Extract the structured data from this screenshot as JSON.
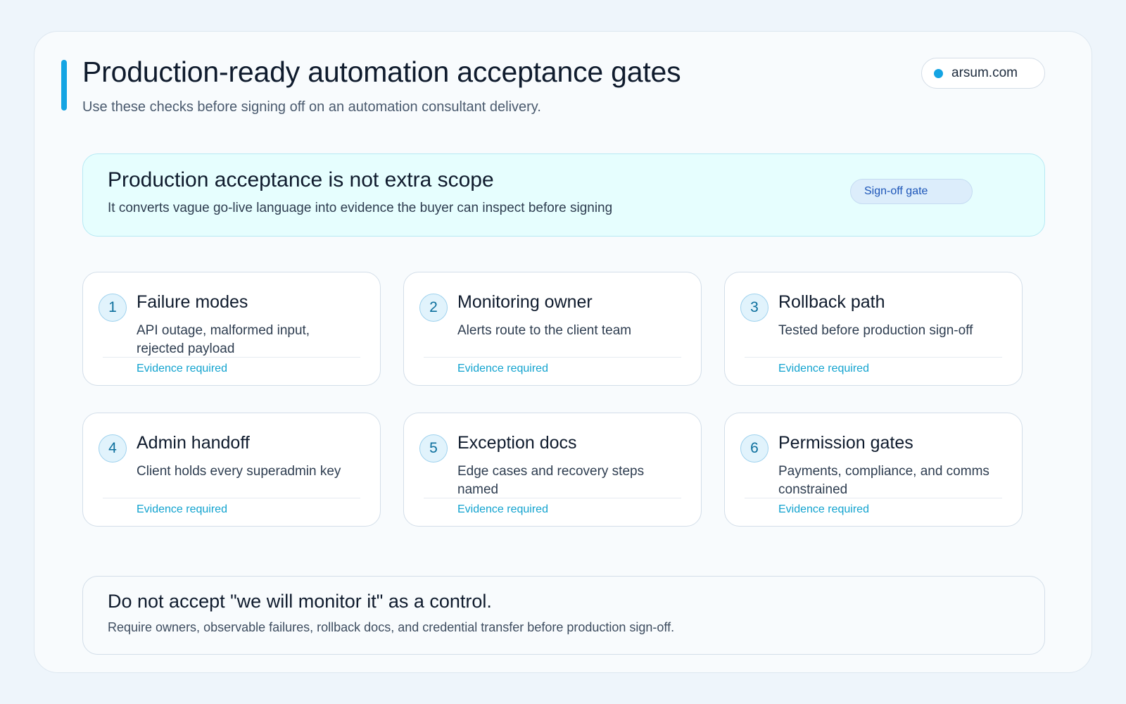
{
  "header": {
    "title": "Production-ready automation acceptance gates",
    "subtitle": "Use these checks before signing off on an automation consultant delivery.",
    "domain": "arsum.com"
  },
  "banner": {
    "title": "Production acceptance is not extra scope",
    "text": "It converts vague go-live language into evidence the buyer can inspect before signing",
    "badge": "Sign-off gate"
  },
  "gates": [
    {
      "number": "1",
      "title": "Failure modes",
      "description": "API outage, malformed input, rejected payload",
      "status": "Evidence required"
    },
    {
      "number": "2",
      "title": "Monitoring owner",
      "description": "Alerts route to the client team",
      "status": "Evidence required"
    },
    {
      "number": "3",
      "title": "Rollback path",
      "description": "Tested before production sign-off",
      "status": "Evidence required"
    },
    {
      "number": "4",
      "title": "Admin handoff",
      "description": "Client holds every superadmin key",
      "status": "Evidence required"
    },
    {
      "number": "5",
      "title": "Exception docs",
      "description": "Edge cases and recovery steps named",
      "status": "Evidence required"
    },
    {
      "number": "6",
      "title": "Permission gates",
      "description": "Payments, compliance, and comms constrained",
      "status": "Evidence required"
    }
  ],
  "footer": {
    "title": "Do not accept \"we will monitor it\" as a control.",
    "text": "Require owners, observable failures, rollback docs, and credential transfer before production sign-off."
  },
  "colors": {
    "accent": "#14a4e3",
    "evidence": "#12a3cf",
    "badge_text": "#1c55b8",
    "banner_bg": "#e6fefe"
  }
}
